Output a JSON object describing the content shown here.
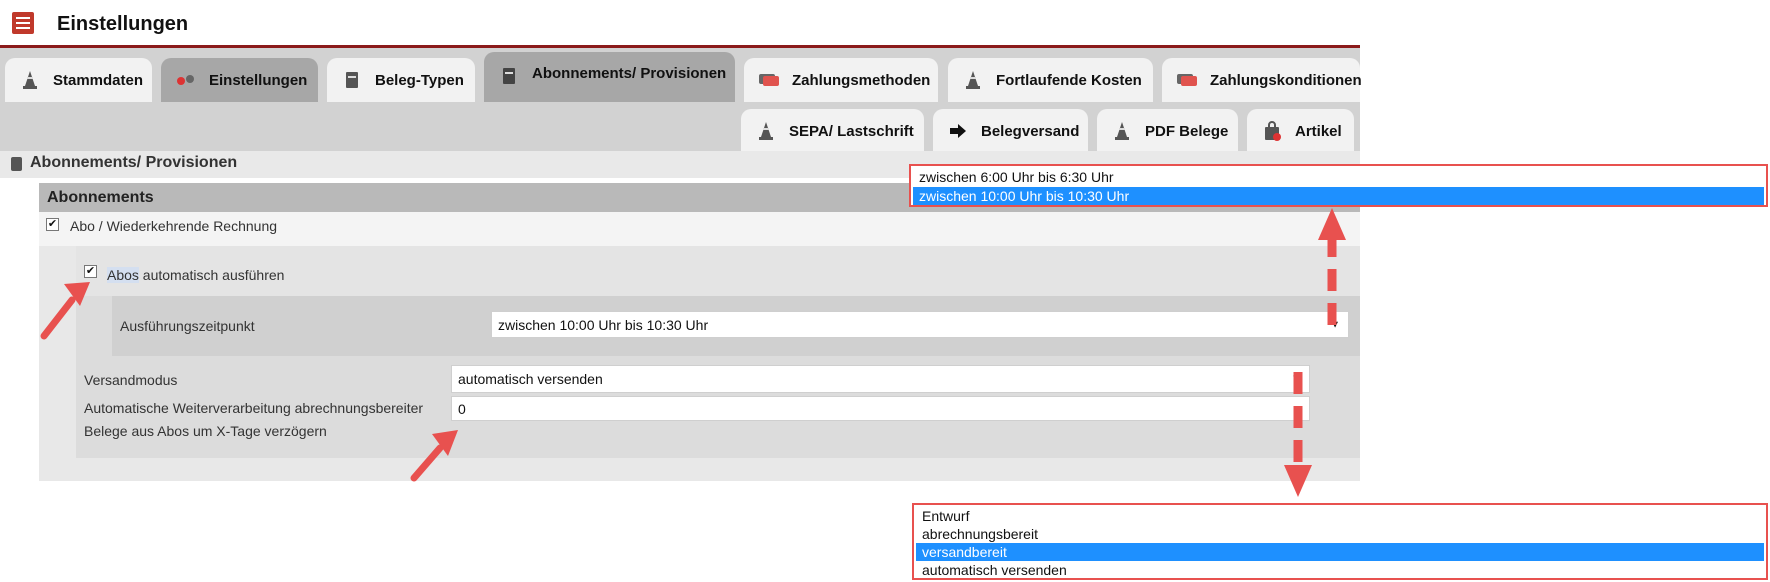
{
  "header": {
    "title": "Einstellungen"
  },
  "tabs_row1": [
    {
      "label": "Stammdaten",
      "icon": "cone-icon",
      "active": false
    },
    {
      "label": "Einstellungen",
      "icon": "toggle-dots-icon",
      "active": true
    },
    {
      "label": "Beleg-Typen",
      "icon": "document-icon",
      "active": false
    },
    {
      "label": "Abonnements/ Provisionen",
      "icon": "document-icon",
      "active": true
    },
    {
      "label": "Zahlungsmethoden",
      "icon": "cards-icon",
      "active": false
    },
    {
      "label": "Fortlaufende Kosten",
      "icon": "cone-icon",
      "active": false
    },
    {
      "label": "Zahlungskonditionen",
      "icon": "cards-icon",
      "active": false
    }
  ],
  "tabs_row2": [
    {
      "label": "SEPA/ Lastschrift",
      "icon": "cone-icon"
    },
    {
      "label": "Belegversand",
      "icon": "arrow-right-icon"
    },
    {
      "label": "PDF Belege",
      "icon": "cone-icon"
    },
    {
      "label": "Artikel",
      "icon": "shopping-bag-icon"
    }
  ],
  "section": {
    "title": "Abonnements/ Provisionen"
  },
  "panel": {
    "title": "Abonnements",
    "abo_checkbox_label": "Abo / Wiederkehrende Rechnung",
    "abo_checked": true,
    "auto_highlight": "Abos",
    "auto_rest": " automatisch ausführen",
    "auto_checked": true,
    "zeitpunkt_label": "Ausführungszeitpunkt",
    "zeitpunkt_value": "zwischen 10:00 Uhr bis 10:30 Uhr",
    "versand_label": "Versandmodus",
    "versand_value": "automatisch versenden",
    "weiter_label_1": "Automatische Weiterverarbeitung abrechnungsbereiter",
    "weiter_label_2": "Belege aus Abos um X-Tage verzögern",
    "weiter_value": "0"
  },
  "zeit_dropdown": {
    "options": [
      "zwischen 6:00 Uhr bis 6:30 Uhr",
      "zwischen 10:00 Uhr bis 10:30 Uhr"
    ],
    "selected_index": 1
  },
  "versand_dropdown": {
    "options": [
      "Entwurf",
      "abrechnungsbereit",
      "versandbereit",
      "automatisch versenden"
    ],
    "selected_index": 2
  },
  "colors": {
    "accent_red": "#e8514f",
    "select_blue": "#1e90ff",
    "header_line": "#8b1a1a"
  }
}
